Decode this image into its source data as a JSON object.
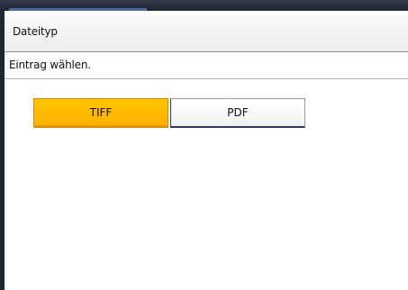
{
  "screen": {
    "title": "Dateityp",
    "instruction": "Eintrag wählen."
  },
  "options": [
    {
      "label": "TIFF",
      "selected": true
    },
    {
      "label": "PDF",
      "selected": false
    }
  ],
  "colors": {
    "selected_bg": "#ffb000",
    "unselected_bg": "#ffffff",
    "frame": "#1e2533"
  }
}
